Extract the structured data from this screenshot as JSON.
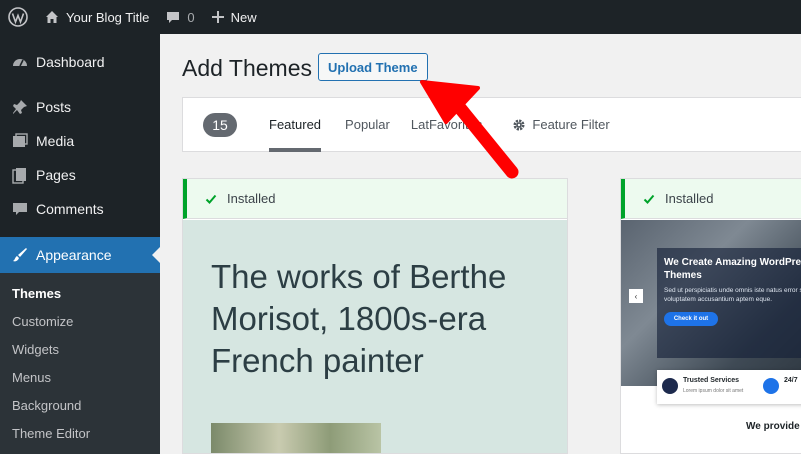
{
  "adminbar": {
    "site_title": "Your Blog Title",
    "comments_count": "0",
    "new_label": "New"
  },
  "sidebar": {
    "items": [
      {
        "label": "Dashboard",
        "icon": "dashboard-icon"
      },
      {
        "label": "Posts",
        "icon": "pin-icon"
      },
      {
        "label": "Media",
        "icon": "media-icon"
      },
      {
        "label": "Pages",
        "icon": "pages-icon"
      },
      {
        "label": "Comments",
        "icon": "comment-icon"
      },
      {
        "label": "Appearance",
        "icon": "brush-icon"
      }
    ],
    "submenu": [
      "Themes",
      "Customize",
      "Widgets",
      "Menus",
      "Background",
      "Theme Editor"
    ]
  },
  "page": {
    "title": "Add Themes",
    "upload_label": "Upload Theme"
  },
  "filter": {
    "count": "15",
    "tabs": [
      "Featured",
      "Popular",
      "Lat",
      "Favorites"
    ],
    "feature_filter_label": "Feature Filter"
  },
  "themes": [
    {
      "installed_label": "Installed",
      "screenshot_title": "The works of Berthe Morisot, 1800s-era French painter"
    },
    {
      "installed_label": "Installed",
      "hero_title": "We Create Amazing WordPre Themes",
      "hero_text": "Sed ut perspiciatis unde omnis iste natus error sit voluptatem accusantium aptem eque.",
      "hero_button": "Check it out",
      "service1_title": "Trusted Services",
      "service1_sub": "Lorem ipsum dolor sit amet",
      "service2_title": "24/7",
      "provide_text": "We provide"
    }
  ],
  "colors": {
    "admin_dark": "#1d2327",
    "accent": "#2271b1",
    "installed_green": "#00a32a",
    "annotation_red": "#ff0000"
  }
}
